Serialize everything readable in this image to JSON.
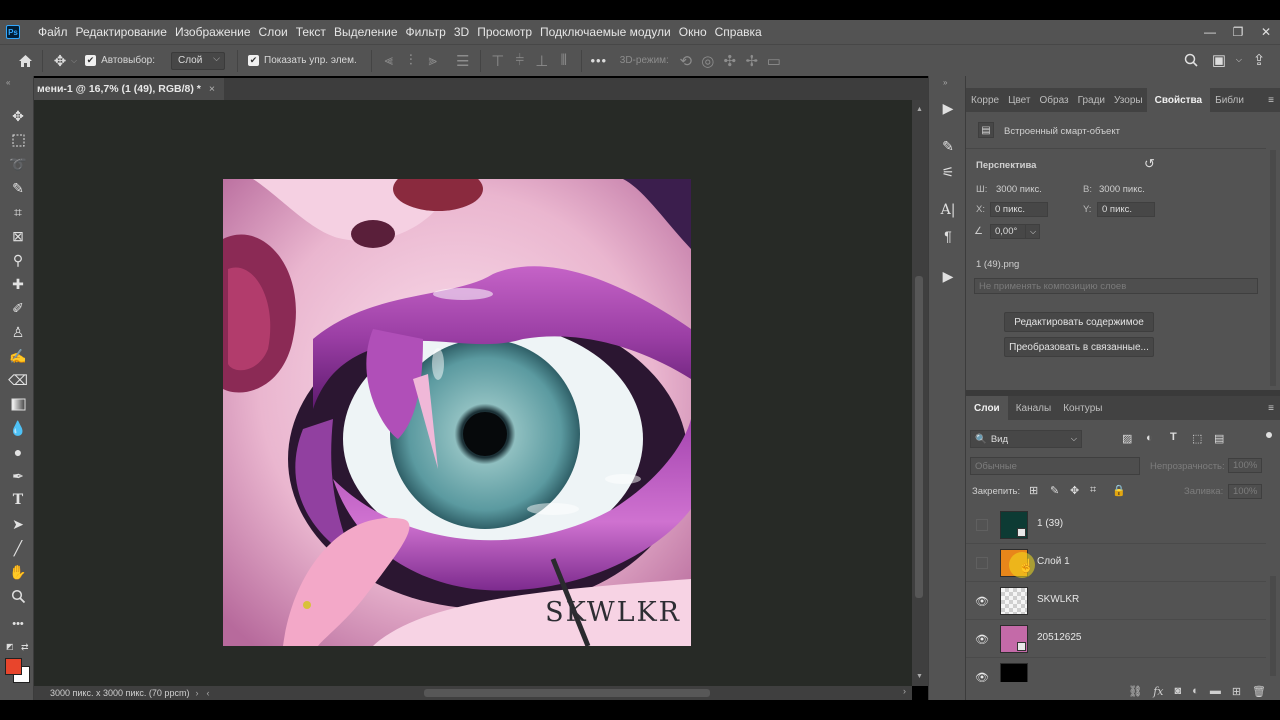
{
  "app": {
    "logo": "Ps"
  },
  "menu": [
    "Файл",
    "Редактирование",
    "Изображение",
    "Слои",
    "Текст",
    "Выделение",
    "Фильтр",
    "3D",
    "Просмотр",
    "Подключаемые модули",
    "Окно",
    "Справка"
  ],
  "window_controls": {
    "minimize": "—",
    "restore": "❐",
    "close": "✕"
  },
  "options_bar": {
    "autoselect_label": "Автовыбор:",
    "autoselect_value": "Слой",
    "show_transform_label": "Показать упр. элем.",
    "three_d_mode": "3D-режим:"
  },
  "document_tab": {
    "title": "мени-1 @ 16,7% (1 (49), RGB/8) *",
    "close": "×"
  },
  "canvas": {
    "watermark": "SKWLKR"
  },
  "status": {
    "doc_size": "3000 пикс. x 3000 пикс. (70 ppcm)"
  },
  "properties_panel": {
    "tabs": [
      "Корре",
      "Цвет",
      "Образ",
      "Гради",
      "Узоры",
      "Свойства",
      "Библи"
    ],
    "active_tab": "Свойства",
    "object_type": "Встроенный смарт-объект",
    "section_title": "Перспектива",
    "w_label": "Ш:",
    "w_value": "3000 пикс.",
    "h_label": "В:",
    "h_value": "3000 пикс.",
    "x_label": "X:",
    "x_value": "0 пикс.",
    "y_label": "Y:",
    "y_value": "0 пикс.",
    "angle_value": "0,00°",
    "file_name": "1 (49).png",
    "layer_comp_placeholder": "Не применять композицию слоев",
    "edit_contents_button": "Редактировать содержимое",
    "convert_linked_button": "Преобразовать в связанные..."
  },
  "layers_panel": {
    "tabs": [
      "Слои",
      "Каналы",
      "Контуры"
    ],
    "filter_kind": "Вид",
    "blend_mode": "Обычные",
    "opacity_label": "Непрозрачность:",
    "opacity_value": "100%",
    "lock_label": "Закрепить:",
    "fill_label": "Заливка:",
    "fill_value": "100%",
    "layers": [
      {
        "name": "1 (39)",
        "visible": false,
        "thumb_color": "#0d3b34"
      },
      {
        "name": "Слой 1",
        "visible": false,
        "thumb_color": "#e8861a"
      },
      {
        "name": "SKWLKR",
        "visible": true,
        "thumb_color": "transparent"
      },
      {
        "name": "20512625",
        "visible": true,
        "thumb_color": "#c46aa8"
      }
    ]
  },
  "colors": {
    "foreground": "#e8452c",
    "background": "#ffffff",
    "accent": "#31a8ff"
  }
}
